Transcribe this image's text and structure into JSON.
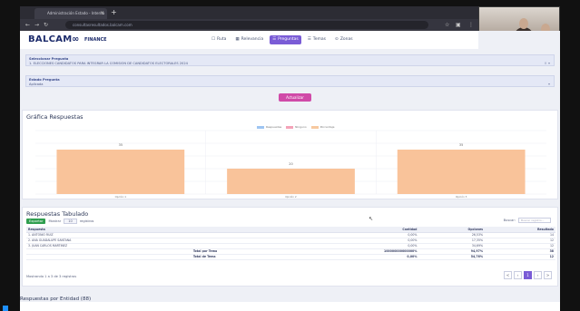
{
  "browser": {
    "tab_title": "Administración Estado - Interna",
    "url": "consultasresultados.balcam.com",
    "new_tab": "+",
    "close": "×"
  },
  "webcam": {
    "label": "BALCAM"
  },
  "app": {
    "logo": "BALCAM",
    "logo_symbol": "∞",
    "logo_suffix": "FINANCE",
    "menu": [
      {
        "label": "Ruta",
        "icon": "☐",
        "active": false
      },
      {
        "label": "Relevancia",
        "icon": "▦",
        "active": false
      },
      {
        "label": "Preguntas",
        "icon": "☰",
        "active": true
      },
      {
        "label": "Temas",
        "icon": "☰",
        "active": false
      },
      {
        "label": "Zonas",
        "icon": "⊙",
        "active": false
      }
    ]
  },
  "filters": {
    "campaign_label": "Seleccionar Pregunta",
    "campaign_value": "1. ELECCIONES CANDIDATOS PARA INTEGRAR LA COMISION DE CANDIDATOS ELECTORALES 2024",
    "question_label": "Estado Pregunta",
    "question_value": "Aplicada",
    "button_label": "Actualizar"
  },
  "chart_card": {
    "title": "Gráfica Respuestas"
  },
  "chart_data": {
    "type": "bar",
    "title": "Gráfica Respuestas",
    "categories": [
      "Opción 1",
      "Opción 2",
      "Opción 3"
    ],
    "values": [
      35,
      20,
      35
    ],
    "ylim": [
      0,
      50
    ],
    "data_labels": [
      "35",
      "20",
      "35"
    ],
    "legend": [
      "Respuestas",
      "Ninguno",
      "Porcentaje"
    ],
    "legend_colors": [
      "#9ec5f2",
      "#f4a3b8",
      "#f7c9a0"
    ],
    "bar_color": "#f9c39a",
    "grid": true,
    "legend_position": "top-center"
  },
  "table_card": {
    "title": "Respuestas Tabulado",
    "excel_label": "Exportar",
    "show_label": "Mostrar",
    "show_value": "10",
    "entries_label": "registros",
    "search_label": "Buscar:",
    "search_placeholder": "Buscar registro...",
    "columns": [
      "Respuesta",
      "",
      "Cantidad",
      "Opciones",
      "Resultado"
    ],
    "rows": [
      [
        "1. ANTONIO RUIZ",
        "",
        "0,00%",
        "26,53%",
        "14"
      ],
      [
        "2. ANA GUADALUPE SANTANA",
        "",
        "0,00%",
        "17,35%",
        "12"
      ],
      [
        "3. JUAN CARLOS MARTINEZ",
        "",
        "0,00%",
        "34,69%",
        "12"
      ]
    ],
    "totals": [
      [
        "",
        "Total por Tema",
        "100000000000000%",
        "94,97%",
        "38"
      ],
      [
        "",
        "Total de Tema",
        "0,00%",
        "54,76%",
        "12"
      ]
    ],
    "info": "Mostrando 1 a 3 de 3 registros",
    "pager": [
      "<",
      "‹",
      "1",
      "›",
      ">"
    ]
  },
  "bottom": {
    "title": "Respuestas por Entidad (88)"
  }
}
